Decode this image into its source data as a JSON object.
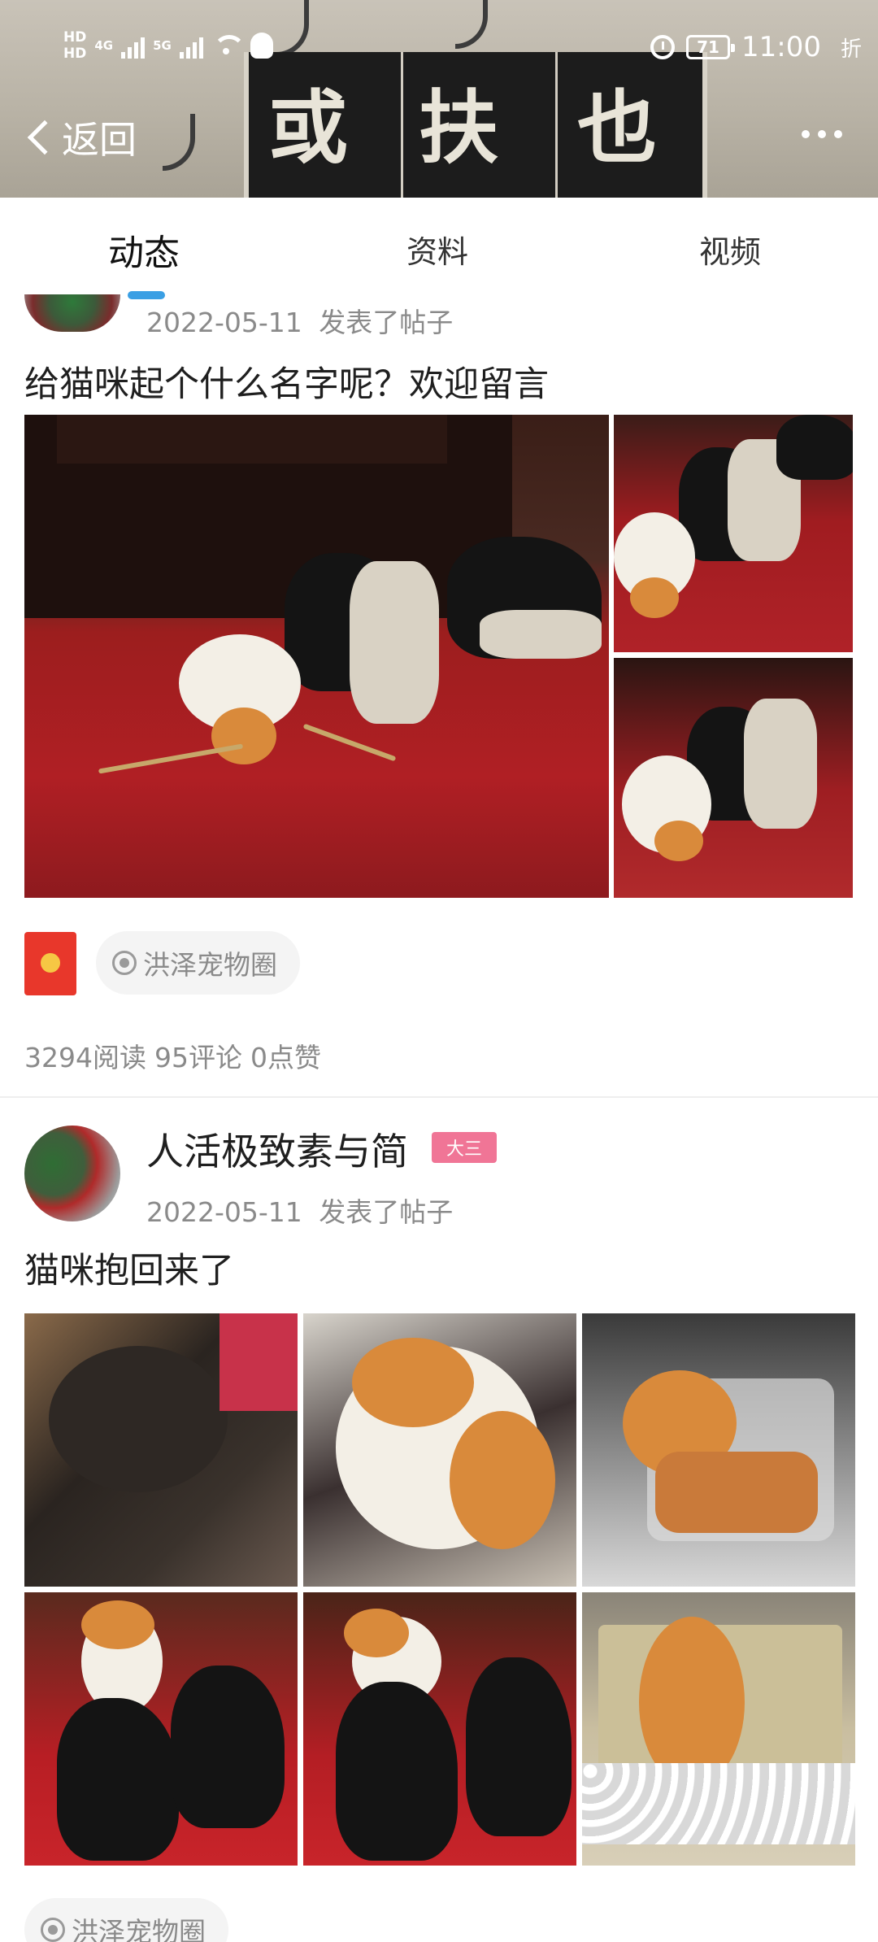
{
  "status_bar": {
    "hd1": "HD",
    "hd2": "HD",
    "net1": "4G",
    "net2": "5G",
    "battery": "71",
    "time": "11:00",
    "fold": "折"
  },
  "header": {
    "back_label": "返回",
    "banner_chars": [
      "或",
      "扶",
      "也"
    ]
  },
  "tabs": [
    {
      "label": "动态",
      "active": true
    },
    {
      "label": "资料",
      "active": false
    },
    {
      "label": "视频",
      "active": false
    }
  ],
  "posts": [
    {
      "date": "2022-05-11",
      "action": "发表了帖子",
      "title": "给猫咪起个什么名字呢？欢迎留言",
      "circle": "洪泽宠物圈",
      "stats": {
        "reads": "3294阅读",
        "comments": "95评论",
        "likes": "0点赞"
      }
    },
    {
      "username": "人活极致素与简",
      "badge": "大三",
      "date": "2022-05-11",
      "action": "发表了帖子",
      "title": "猫咪抱回来了",
      "circle": "洪泽宠物圈"
    }
  ]
}
